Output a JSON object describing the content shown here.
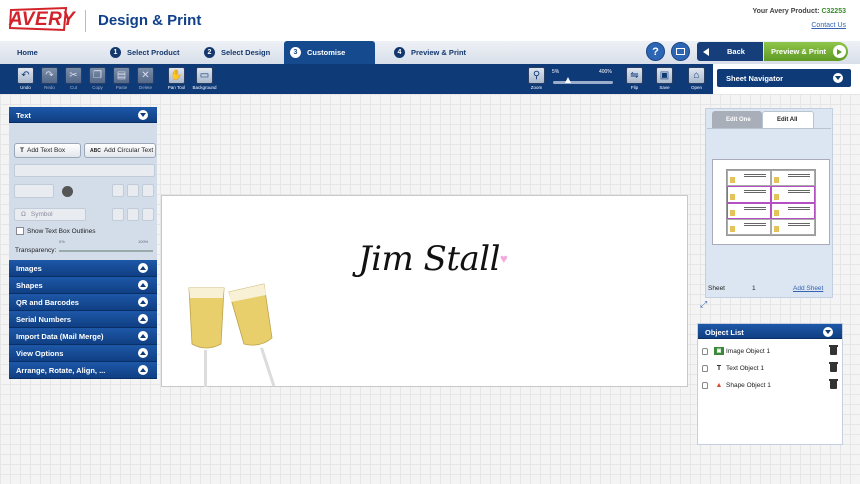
{
  "header": {
    "logo": "AVERY",
    "brand": "Design & Print",
    "product_label": "Your Avery Product:",
    "product_code": "C32253",
    "contact": "Contact Us"
  },
  "steps": {
    "home": "Home",
    "s1": "Select Product",
    "s2": "Select Design",
    "s3": "Customise",
    "s4": "Preview & Print",
    "n1": "1",
    "n2": "2",
    "n3": "3",
    "n4": "4"
  },
  "nav": {
    "help": "?",
    "back": "Back",
    "preview_print": "Preview & Print"
  },
  "toolbar": {
    "undo": "Undo",
    "redo": "Redo",
    "cut": "Cut",
    "copy": "Copy",
    "paste": "Paste",
    "delete": "Delete",
    "pan": "Pan Tool",
    "background": "Background",
    "zoom": "Zoom",
    "zoom_min": "5%",
    "zoom_max": "400%",
    "zoom_level": 0.25,
    "flip": "Flip",
    "save": "Save",
    "open": "Open"
  },
  "sheet_nav": {
    "title": "Sheet Navigator",
    "edit_one": "Edit One",
    "edit_all": "Edit All",
    "sheet_label": "Sheet",
    "sheet_no": "1",
    "add_sheet": "Add Sheet"
  },
  "left": {
    "text_title": "Text",
    "add_text_box": "Add Text Box",
    "add_circular": "Add Circular Text",
    "symbol": "Symbol",
    "show_outlines": "Show Text Box Outlines",
    "transparency": "Transparency:",
    "t_min": "0%",
    "t_max": "100%",
    "sections": [
      "Images",
      "Shapes",
      "QR and Barcodes",
      "Serial Numbers",
      "Import Data (Mail Merge)",
      "View Options",
      "Arrange, Rotate, Align, ..."
    ]
  },
  "canvas": {
    "name_text": "Jim Stall"
  },
  "objects": {
    "title": "Object List",
    "items": [
      "Image Object 1",
      "Text Object 1",
      "Shape Object 1"
    ]
  },
  "colors": {
    "navy": "#0e3a78",
    "green": "#5e9a25",
    "red": "#d2232a",
    "heart": "#f2a9df"
  }
}
